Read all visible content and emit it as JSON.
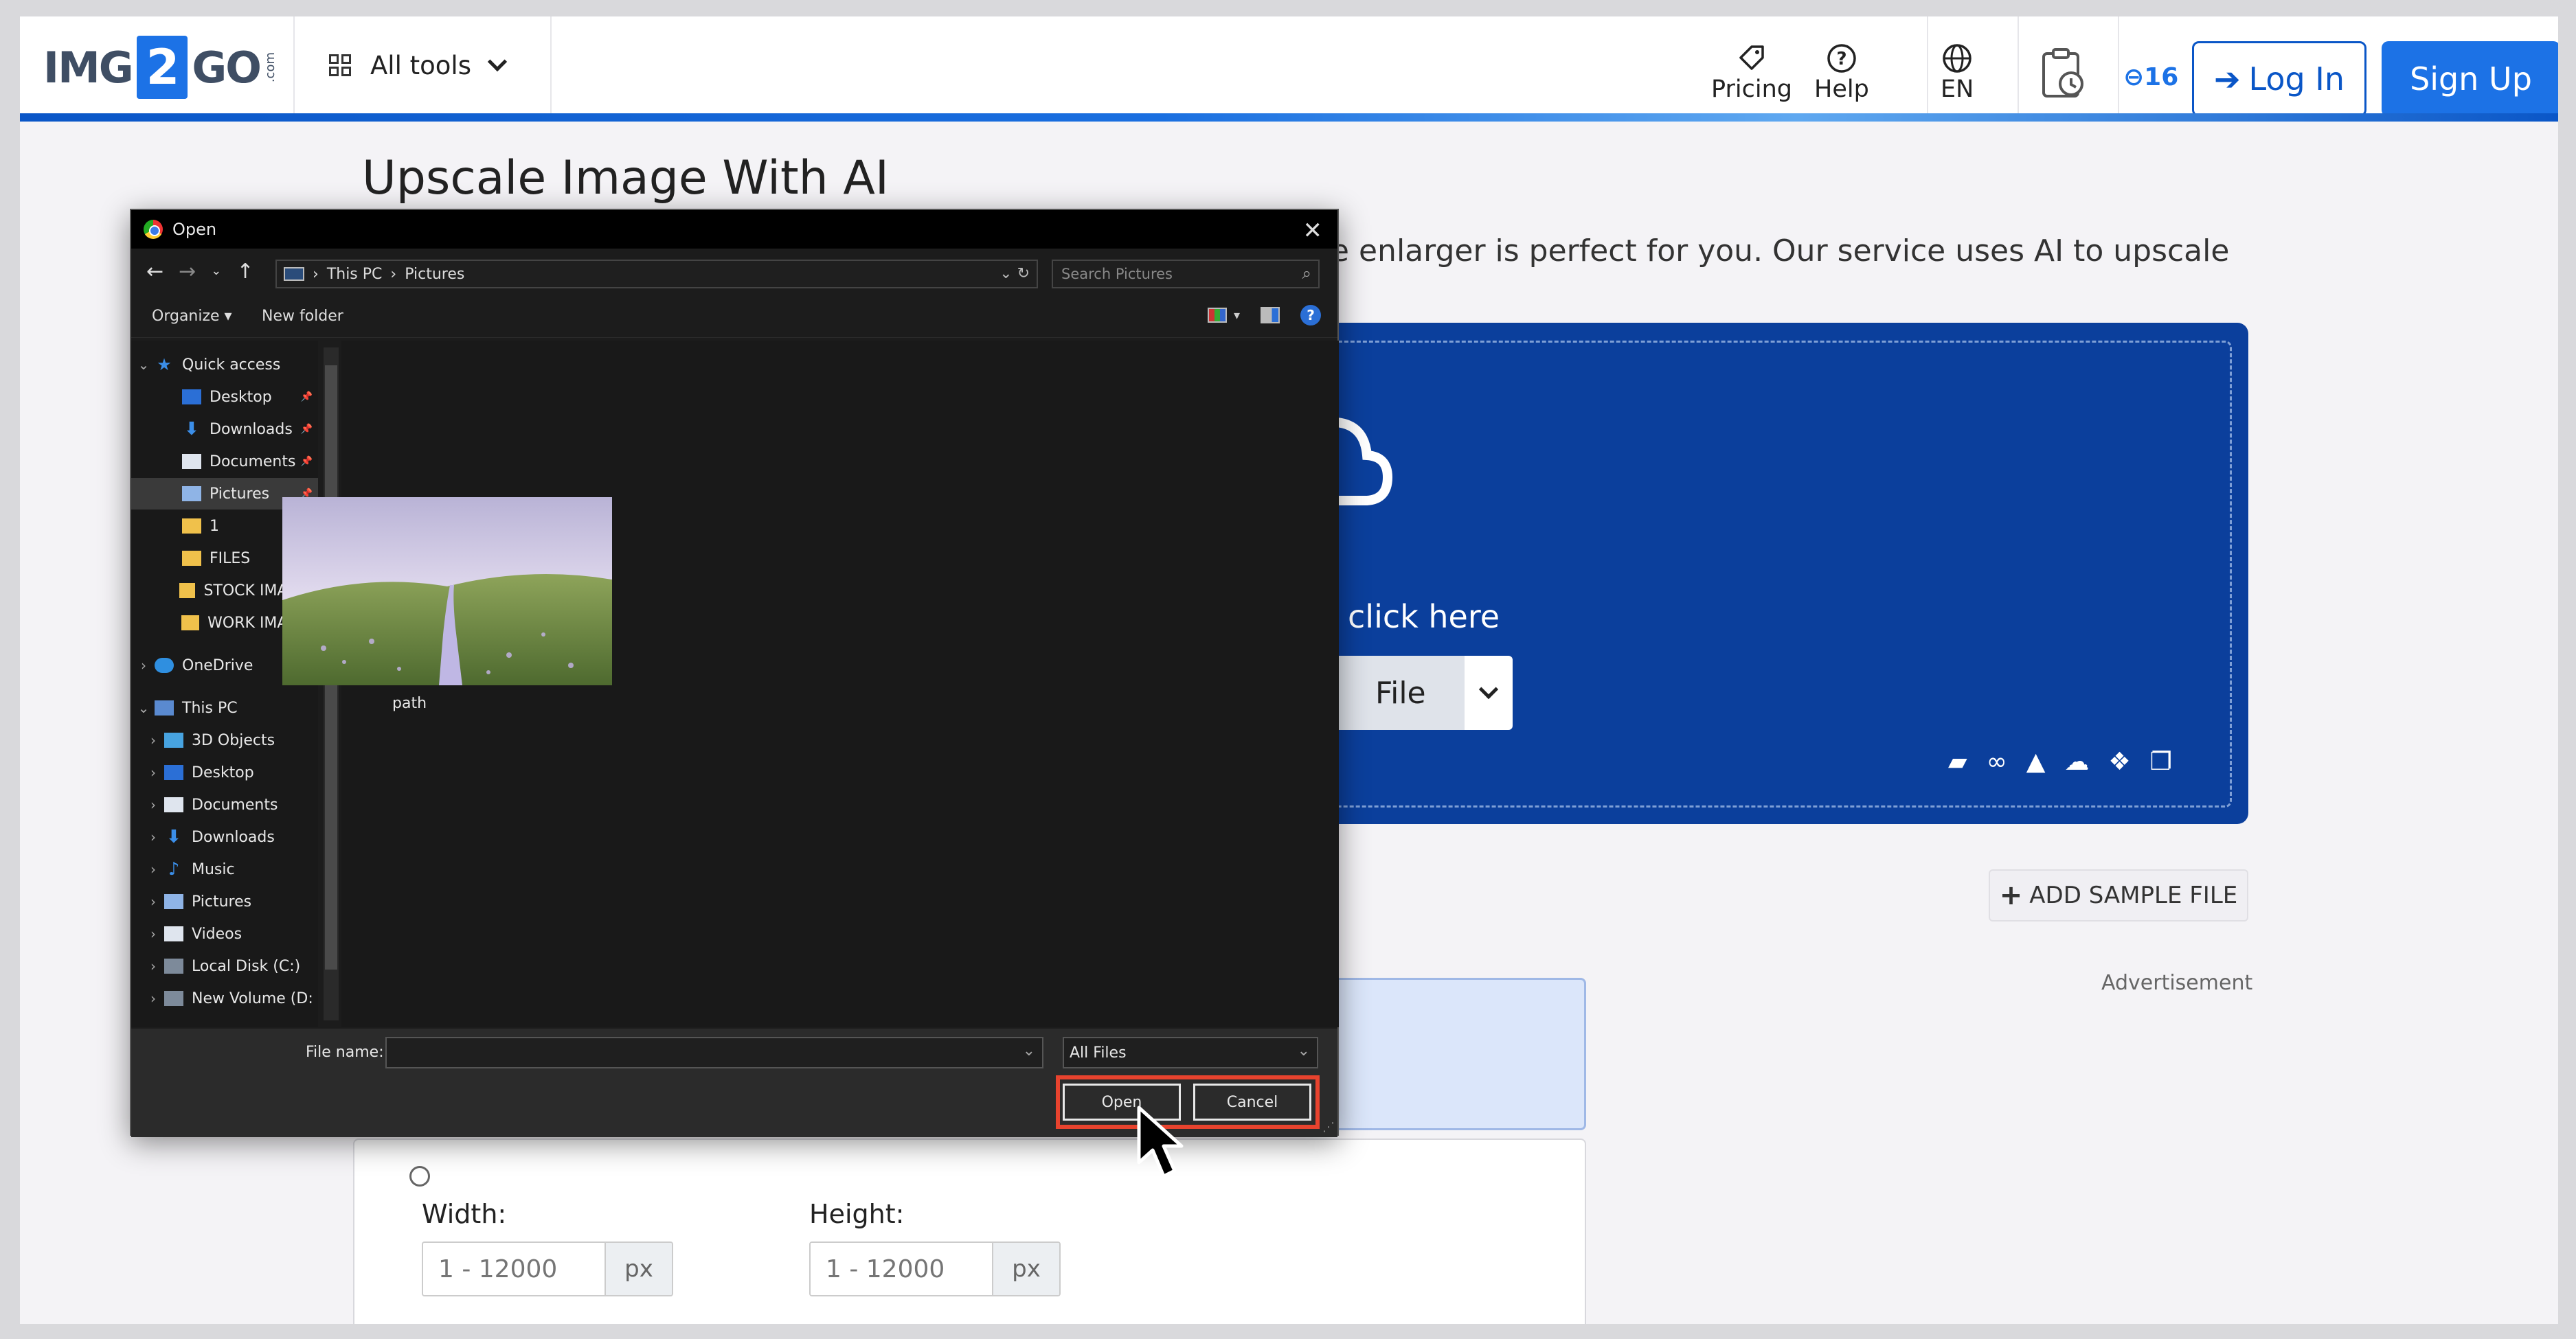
{
  "header": {
    "logo_prefix": "IMG",
    "logo_two": "2",
    "logo_suffix": "GO",
    "logo_dotcom": ".com",
    "all_tools": "All tools",
    "pricing": "Pricing",
    "help": "Help",
    "language": "EN",
    "credits": "16",
    "login": "Log In",
    "signup": "Sign Up"
  },
  "main": {
    "title": "Upscale Image With AI",
    "intro_fragment": "ge enlarger is perfect for you. Our service uses AI to upscale",
    "drop_text": "click here",
    "choose_file": "File",
    "add_sample": "ADD SAMPLE FILE",
    "advertisement": "Advertisement"
  },
  "options": {
    "width_label": "Width:",
    "height_label": "Height:",
    "width_placeholder": "1 - 12000",
    "height_placeholder": "1 - 12000",
    "unit": "px"
  },
  "dialog": {
    "title": "Open",
    "breadcrumb": [
      "This PC",
      "Pictures"
    ],
    "search_placeholder": "Search Pictures",
    "organize": "Organize",
    "new_folder": "New folder",
    "nav": [
      {
        "label": "Quick access",
        "icon": "star-icon"
      },
      {
        "label": "Desktop",
        "icon": "desktop-icon"
      },
      {
        "label": "Downloads",
        "icon": "download-icon"
      },
      {
        "label": "Documents",
        "icon": "document-icon"
      },
      {
        "label": "Pictures",
        "icon": "pictures-icon"
      },
      {
        "label": "1",
        "icon": "folder-icon"
      },
      {
        "label": "FILES",
        "icon": "folder-icon"
      },
      {
        "label": "STOCK IMAGES",
        "icon": "folder-icon"
      },
      {
        "label": "WORK IMAGES",
        "icon": "folder-icon"
      },
      {
        "label": "OneDrive",
        "icon": "cloud-icon"
      },
      {
        "label": "This PC",
        "icon": "computer-icon"
      },
      {
        "label": "3D Objects",
        "icon": "cube-icon"
      },
      {
        "label": "Desktop",
        "icon": "desktop-icon"
      },
      {
        "label": "Documents",
        "icon": "document-icon"
      },
      {
        "label": "Downloads",
        "icon": "download-icon"
      },
      {
        "label": "Music",
        "icon": "music-icon"
      },
      {
        "label": "Pictures",
        "icon": "pictures-icon"
      },
      {
        "label": "Videos",
        "icon": "video-icon"
      },
      {
        "label": "Local Disk (C:)",
        "icon": "disk-icon"
      },
      {
        "label": "New Volume (D:",
        "icon": "disk-icon"
      }
    ],
    "file": {
      "name": "path"
    },
    "file_name_label": "File name:",
    "file_name_value": "",
    "file_type": "All Files",
    "open_button": "Open",
    "cancel_button": "Cancel"
  },
  "colors": {
    "brand_blue": "#1c72e6",
    "upload_bg": "#0b3f9c",
    "highlight_red": "#e8432e"
  }
}
